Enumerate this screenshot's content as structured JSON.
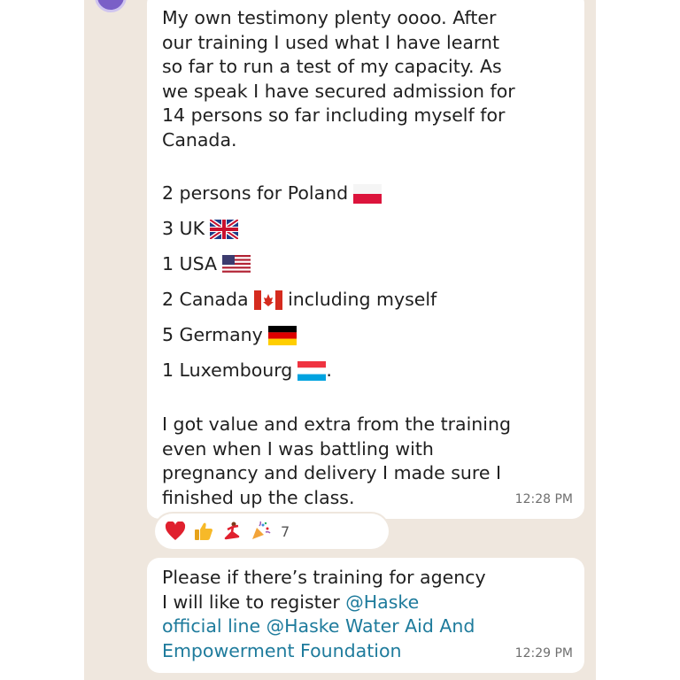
{
  "message1": {
    "paragraph1": [
      "My own testimony plenty oooo. After",
      "our training I used what I have learnt",
      "so far to run a test of my capacity. As",
      "we speak I have secured admission for",
      "14 persons so far including myself for",
      "Canada."
    ],
    "countries": [
      {
        "text": "2 persons for Poland",
        "flag": "poland-flag-icon",
        "suffix": ""
      },
      {
        "text": "3 UK",
        "flag": "uk-flag-icon",
        "suffix": ""
      },
      {
        "text": "1 USA",
        "flag": "usa-flag-icon",
        "suffix": ""
      },
      {
        "text": "2 Canada",
        "flag": "canada-flag-icon",
        "suffix": " including myself"
      },
      {
        "text": "5 Germany",
        "flag": "germany-flag-icon",
        "suffix": ""
      },
      {
        "text": "1 Luxembourg",
        "flag": "luxembourg-flag-icon",
        "suffix": "."
      }
    ],
    "paragraph2": [
      "I got value and extra from the training",
      "even when I was battling with",
      "pregnancy and delivery I made sure I",
      "finished up the class."
    ],
    "time": "12:28 PM"
  },
  "reactions": {
    "icons": [
      "red-heart-icon",
      "thumbs-up-icon",
      "dancer-icon",
      "party-popper-icon"
    ],
    "count": "7"
  },
  "message2": {
    "line1": "Please if there’s training for agency",
    "line2_text": "I will like to register ",
    "line2_mention": "@Haske",
    "line3": "official line @Haske Water Aid And",
    "line4": "Empowerment Foundation",
    "time": "12:29 PM"
  },
  "colors": {
    "chat_background": "#efe7de",
    "bubble": "#ffffff",
    "mention": "#1e7b9c",
    "avatar": "#7a5fc7"
  }
}
